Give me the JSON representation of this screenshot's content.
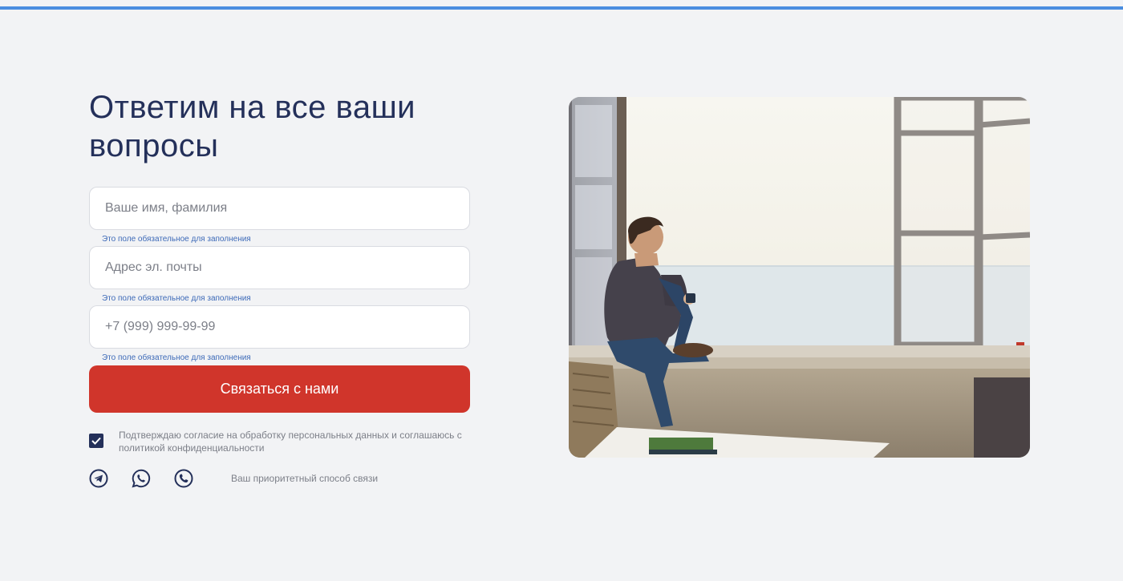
{
  "headline": "Ответим на все ваши вопросы",
  "form": {
    "name_placeholder": "Ваше имя, фамилия",
    "email_placeholder": "Адрес эл. почты",
    "phone_placeholder": "+7 (999) 999-99-99",
    "required_hint": "Это поле обязательное для заполнения",
    "submit_label": "Связаться с нами",
    "consent_text": "Подтверждаю согласие на обработку персональных данных и соглашаюсь с политикой конфиденциальности",
    "consent_checked": true
  },
  "contacts": {
    "icons": [
      "telegram-icon",
      "whatsapp-icon",
      "phone-icon"
    ],
    "label": "Ваш приоритетный способ связи"
  },
  "colors": {
    "accent_bar": "#4a8de0",
    "headline": "#24305a",
    "button": "#d0352b",
    "hint": "#3d6ab8"
  }
}
